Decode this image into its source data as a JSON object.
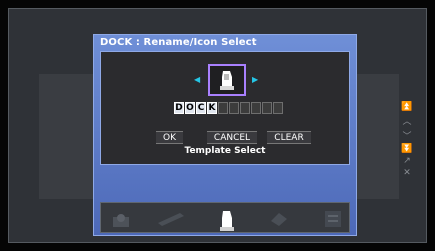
{
  "dialog": {
    "title": "DOCK : Rename/Icon Select",
    "name_cells": [
      "D",
      "O",
      "C",
      "K",
      "",
      "",
      "",
      "",
      "",
      ""
    ],
    "buttons": {
      "ok": "OK",
      "cancel": "CANCEL",
      "clear": "CLEAR"
    },
    "template_select": "Template Select",
    "selected_icon": "dock-icon"
  },
  "side_controls": [
    "arrow-up-double",
    "arrow-up",
    "arrow-down",
    "arrow-down-double",
    "edit",
    "close"
  ],
  "tray_icons": [
    "gear-icon",
    "cartridge-icon",
    "dock-icon",
    "controller-icon",
    "document-icon"
  ],
  "colors": {
    "dialog": "#5f7fcc",
    "accent_arrows": "#25c6e6",
    "selection": "#a980ff"
  }
}
